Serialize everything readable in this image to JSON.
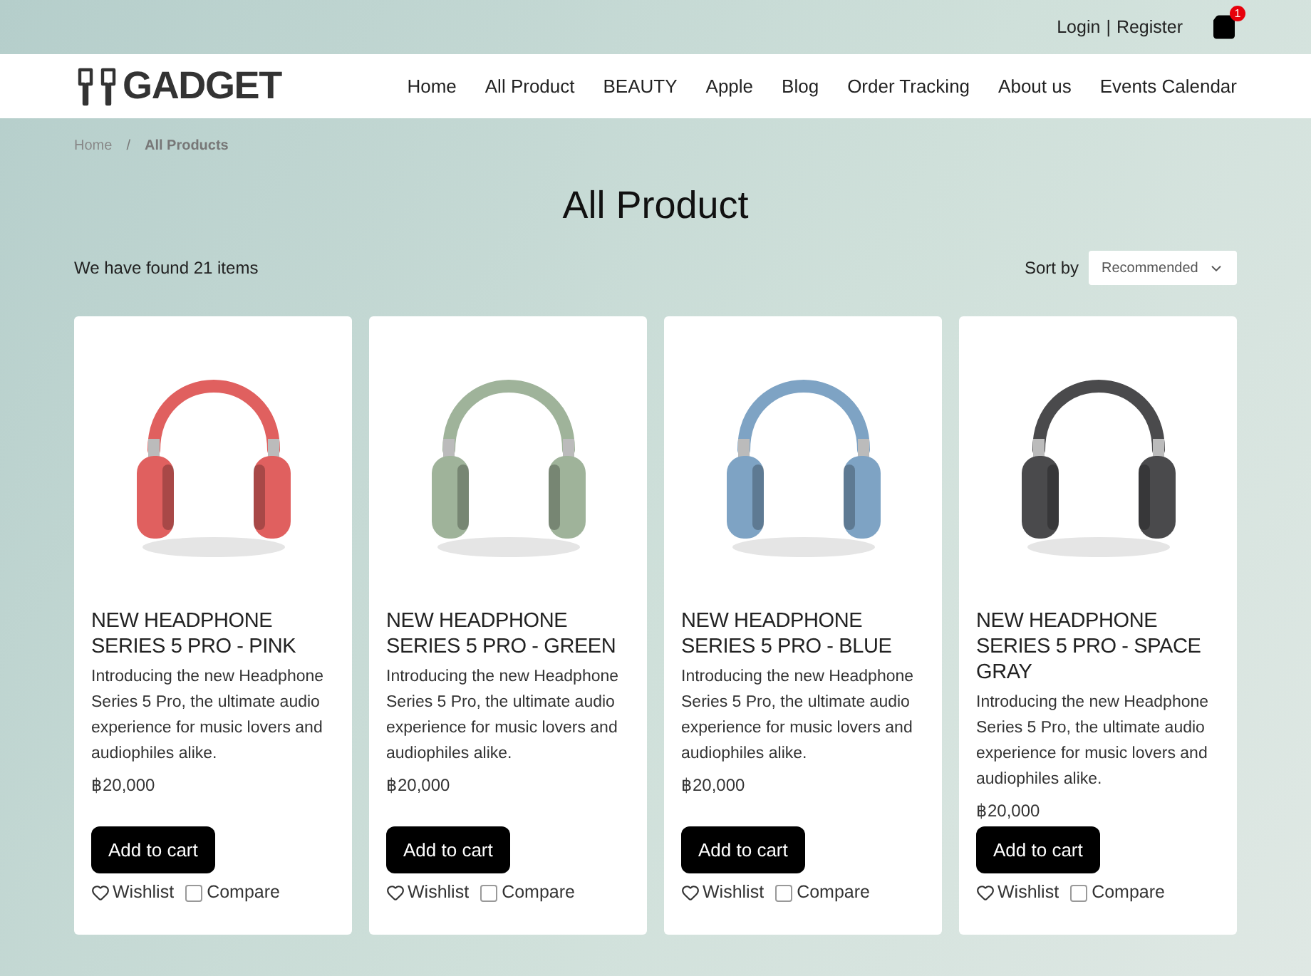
{
  "top_bar": {
    "login": "Login",
    "separator": "|",
    "register": "Register",
    "cart_count": "1"
  },
  "header": {
    "logo": "GADGET",
    "nav": [
      {
        "label": "Home"
      },
      {
        "label": "All Product"
      },
      {
        "label": "BEAUTY"
      },
      {
        "label": "Apple"
      },
      {
        "label": "Blog"
      },
      {
        "label": "Order Tracking"
      },
      {
        "label": "About us"
      },
      {
        "label": "Events Calendar"
      }
    ]
  },
  "breadcrumb": {
    "separator": "/",
    "items": [
      {
        "label": "Home"
      },
      {
        "label": "All Products"
      }
    ]
  },
  "title": "All Product",
  "results": "We have found 21 items",
  "sort": {
    "label": "Sort by",
    "value": "Recommended"
  },
  "products": [
    {
      "name": "NEW HEADPHONE SERIES 5 PRO - PINK",
      "color": "#e0605f",
      "description": "Introducing the new Headphone Series 5 Pro, the ultimate audio experience for music lovers and audiophiles alike.",
      "price": "฿20,000",
      "button": "Add to cart",
      "wishlist": "Wishlist",
      "compare": "Compare",
      "compare_checked": false
    },
    {
      "name": "NEW HEADPHONE SERIES 5 PRO - GREEN",
      "color": "#9fb39a",
      "description": "Introducing the new Headphone Series 5 Pro, the ultimate audio experience for music lovers and audiophiles alike.",
      "price": "฿20,000",
      "button": "Add to cart",
      "wishlist": "Wishlist",
      "compare": "Compare",
      "compare_checked": false
    },
    {
      "name": "NEW HEADPHONE SERIES 5 PRO - BLUE",
      "color": "#7ea3c4",
      "description": "Introducing the new Headphone Series 5 Pro, the ultimate audio experience for music lovers and audiophiles alike.",
      "price": "฿20,000",
      "button": "Add to cart",
      "wishlist": "Wishlist",
      "compare": "Compare",
      "compare_checked": false
    },
    {
      "name": "NEW HEADPHONE SERIES 5 PRO - SPACE GRAY",
      "color": "#4a4a4c",
      "description": "Introducing the new Headphone Series 5 Pro, the ultimate audio experience for music lovers and audiophiles alike.",
      "price": "฿20,000",
      "button": "Add to cart",
      "wishlist": "Wishlist",
      "compare": "Compare",
      "compare_checked": false
    }
  ]
}
